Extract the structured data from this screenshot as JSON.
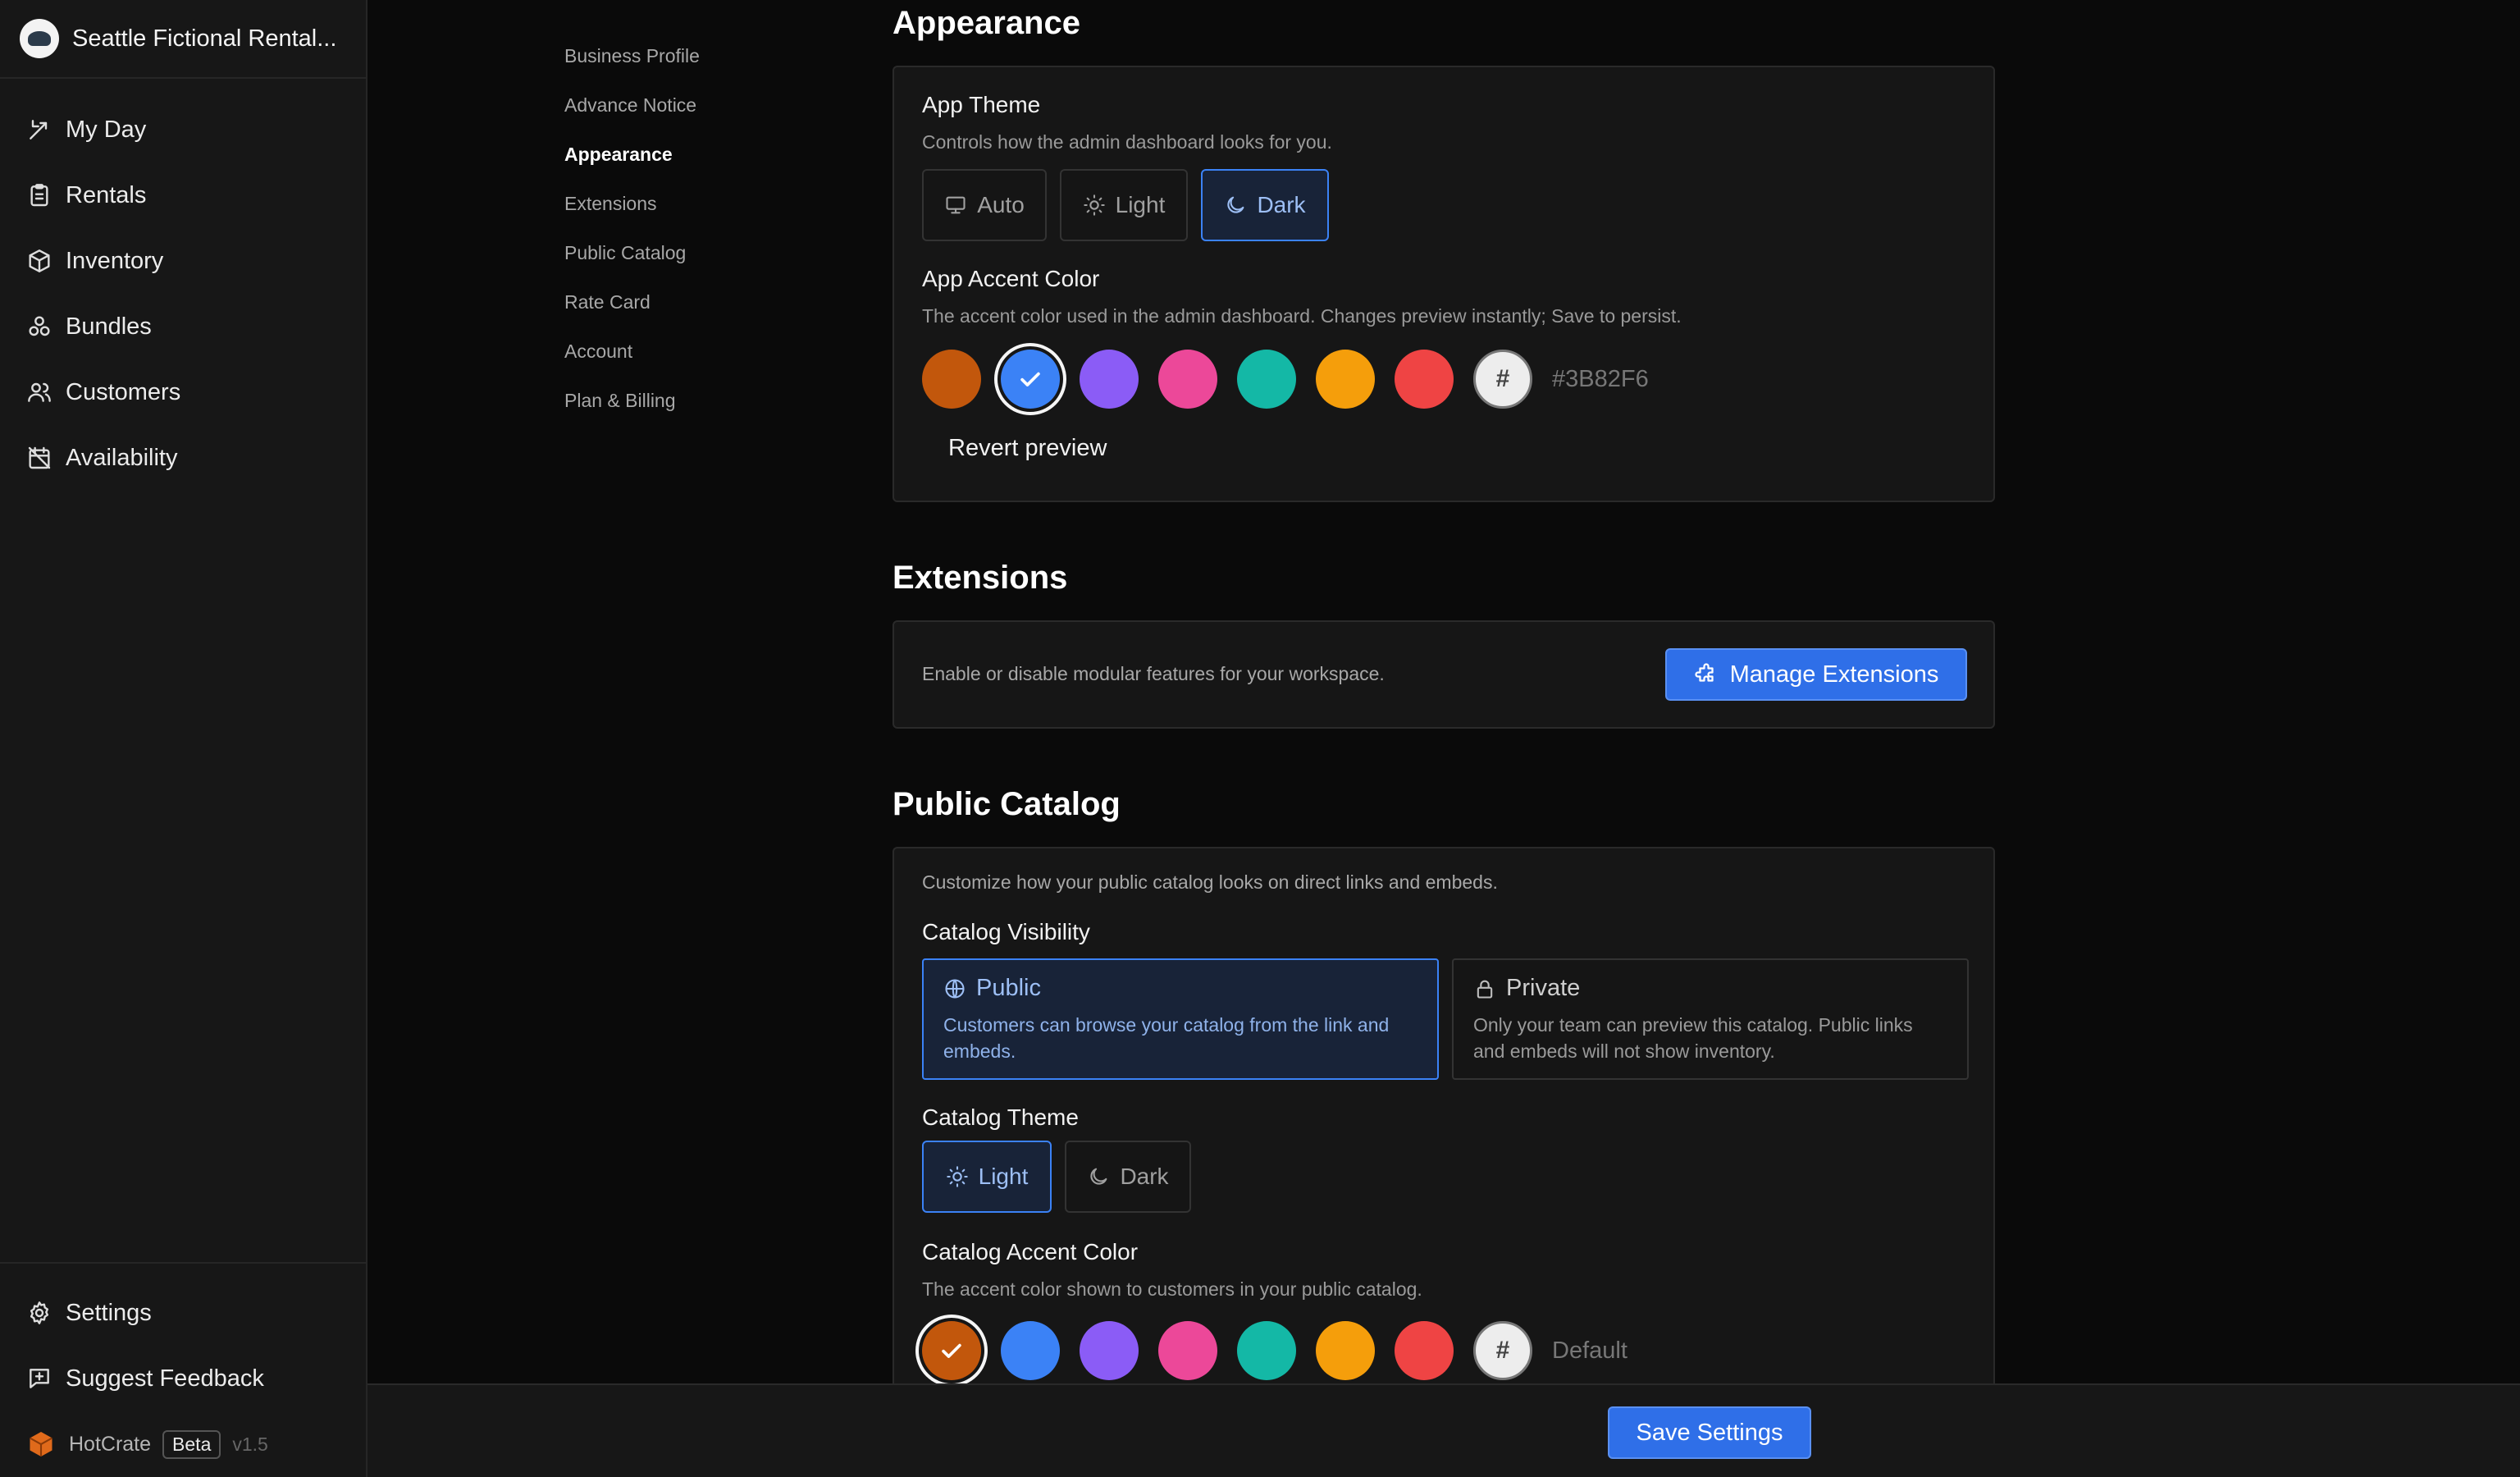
{
  "sidebar": {
    "brand_name": "Seattle Fictional Rental...",
    "items": [
      {
        "label": "My Day",
        "icon": "arrows-icon"
      },
      {
        "label": "Rentals",
        "icon": "clipboard-icon"
      },
      {
        "label": "Inventory",
        "icon": "box-icon"
      },
      {
        "label": "Bundles",
        "icon": "bundles-icon"
      },
      {
        "label": "Customers",
        "icon": "users-icon"
      },
      {
        "label": "Availability",
        "icon": "calendar-off-icon"
      }
    ],
    "bottom": [
      {
        "label": "Settings",
        "icon": "gear-icon"
      },
      {
        "label": "Suggest Feedback",
        "icon": "feedback-icon"
      }
    ],
    "app_name": "HotCrate",
    "badge": "Beta",
    "version": "v1.5"
  },
  "subnav": {
    "items": [
      "Business Profile",
      "Advance Notice",
      "Appearance",
      "Extensions",
      "Public Catalog",
      "Rate Card",
      "Account",
      "Plan & Billing"
    ],
    "active": "Appearance"
  },
  "appearance": {
    "title": "Appearance",
    "theme_label": "App Theme",
    "theme_help": "Controls how the admin dashboard looks for you.",
    "theme_options": [
      "Auto",
      "Light",
      "Dark"
    ],
    "theme_selected": "Dark",
    "accent_label": "App Accent Color",
    "accent_help": "The accent color used in the admin dashboard. Changes preview instantly; Save to persist.",
    "accent_hex": "#3B82F6",
    "custom_glyph": "#",
    "revert_label": "Revert preview"
  },
  "extensions": {
    "title": "Extensions",
    "description": "Enable or disable modular features for your workspace.",
    "button_label": "Manage Extensions"
  },
  "public_catalog": {
    "title": "Public Catalog",
    "description": "Customize how your public catalog looks on direct links and embeds.",
    "visibility_label": "Catalog Visibility",
    "public_title": "Public",
    "public_desc": "Customers can browse your catalog from the link and embeds.",
    "private_title": "Private",
    "private_desc": "Only your team can preview this catalog. Public links and embeds will not show inventory.",
    "visibility_selected": "Public",
    "theme_label": "Catalog Theme",
    "theme_options": [
      "Light",
      "Dark"
    ],
    "theme_selected": "Light",
    "accent_label": "Catalog Accent Color",
    "accent_help": "The accent color shown to customers in your public catalog.",
    "accent_value": "Default"
  },
  "swatch_colors": [
    "#c2570c",
    "#3b82f6",
    "#8b5cf6",
    "#ec4899",
    "#14b8a6",
    "#f59e0b",
    "#ef4444"
  ],
  "app_accent_selected_index": 1,
  "catalog_accent_selected_index": 0,
  "footer": {
    "save_label": "Save Settings"
  }
}
